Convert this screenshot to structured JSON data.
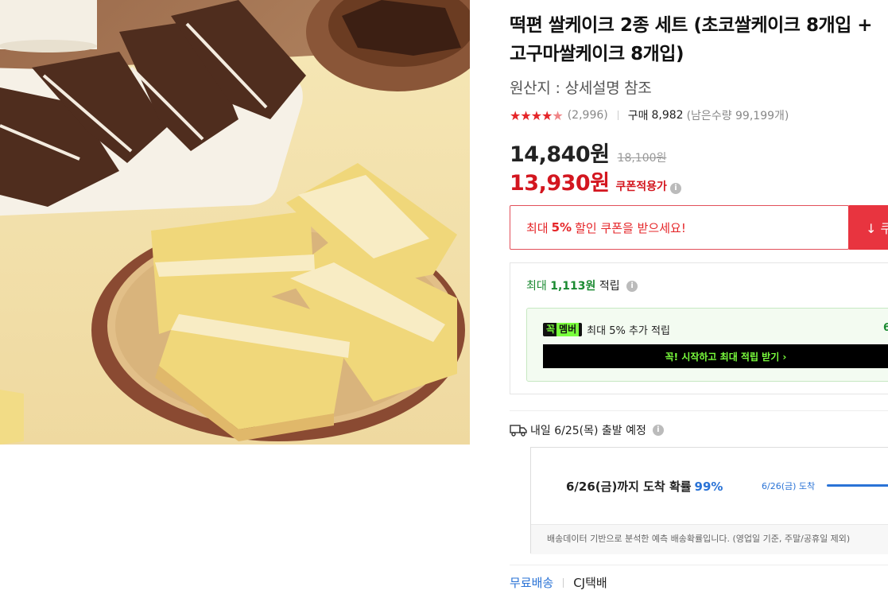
{
  "product": {
    "title": "떡편 쌀케이크 2종 세트 (초코쌀케이크 8개입 + 고구마쌀케이크 8개입)",
    "origin_label": "원산지",
    "origin_sep": ":",
    "origin_value": "상세설명 참조",
    "rating_stars": 4.5,
    "rating_count": "(2,996)",
    "purchase_label": "구매",
    "purchase_count": "8,982",
    "remaining": "(남은수량 99,199개)"
  },
  "price": {
    "sale": "14,840원",
    "original": "18,100원",
    "coupon_price": "13,930원",
    "coupon_tag": "쿠폰적용가"
  },
  "coupon": {
    "prefix": "최대",
    "percent": "5%",
    "suffix": "할인 쿠폰을 받으세요!",
    "button_label": "↓ 쿠"
  },
  "reward": {
    "head_prefix": "최대",
    "amount": "1,113원",
    "head_suffix": "적립",
    "member_badge_left": "꼭",
    "member_badge_right": "멤버",
    "member_text": "최대 5% 추가 적립",
    "member_right": "6",
    "cta": "꼭! 시작하고 최대 적립 받기 ›"
  },
  "shipping": {
    "departure": "내일 6/25(목) 출발 예정",
    "eta_text": "6/26(금)까지 도착 확률",
    "eta_pct": "99%",
    "eta_mini": "6/26(금) 도착",
    "eta_progress": 0.99,
    "note": "배송데이터 기반으로 분석한 예측 배송확률입니다. (영업일 기준, 주말/공휴일 제외)",
    "free_label": "무료배송",
    "carrier": "CJ택배"
  },
  "icons": {
    "info": "info-icon",
    "truck": "truck-icon",
    "download": "download-arrow-icon",
    "star": "star-icon"
  },
  "colors": {
    "accent_red": "#e52528",
    "reward_green": "#1a8a31",
    "member_neon": "#7aff3d",
    "link_blue": "#2a73d6"
  }
}
